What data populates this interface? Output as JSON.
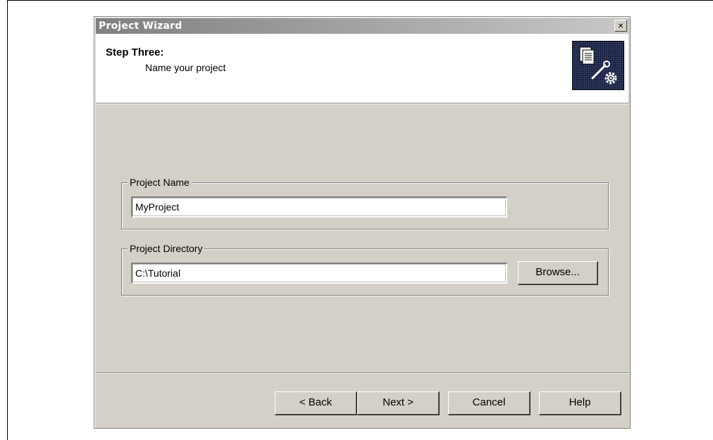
{
  "window": {
    "title": "Project Wizard",
    "close_label": "×"
  },
  "header": {
    "step_title": "Step Three:",
    "step_subtitle": "Name your project",
    "icon": "project-wizard-icon"
  },
  "project_name": {
    "label": "Project Name",
    "value": "MyProject"
  },
  "project_directory": {
    "label": "Project Directory",
    "value": "C:\\Tutorial",
    "browse_label": "Browse..."
  },
  "footer": {
    "back_label": "< Back",
    "next_label": "Next >",
    "cancel_label": "Cancel",
    "help_label": "Help"
  },
  "colors": {
    "dialog_bg": "#d4d0c8",
    "titlebar_start": "#808080",
    "titlebar_end": "#c8c8c8",
    "icon_bg": "#1a1f3a"
  }
}
